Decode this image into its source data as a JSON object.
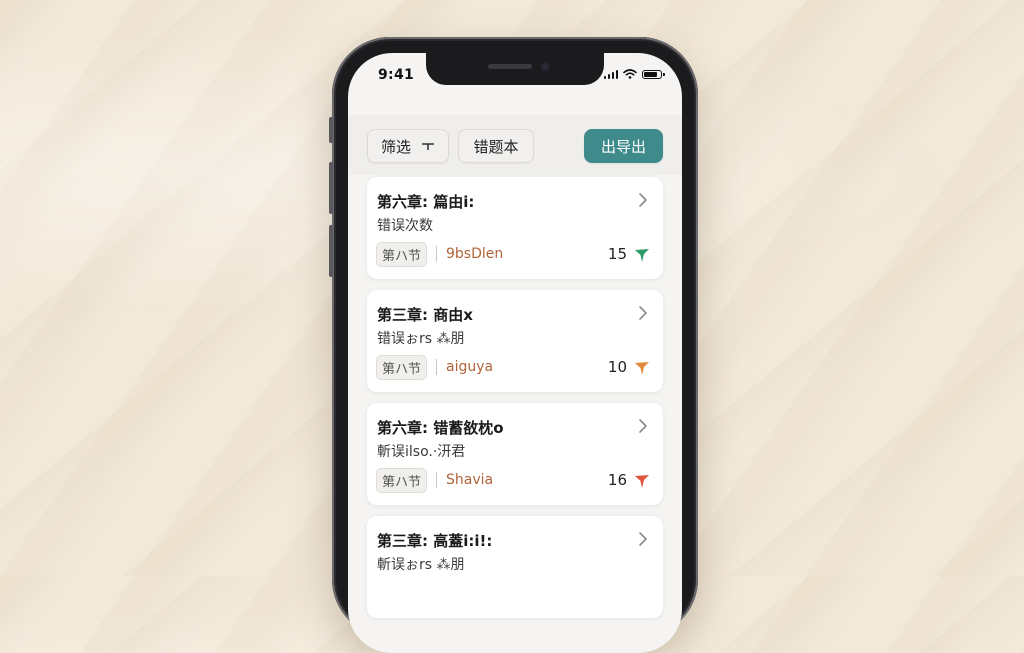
{
  "status_bar": {
    "time": "9:41"
  },
  "toolbar": {
    "filter_label": "筛选",
    "filter_icon": "filter-adjust-icon",
    "wrongbook_label": "错题本",
    "export_label": "出导出",
    "export_color": "#3f8a8a"
  },
  "cards": [
    {
      "title": "第六章: 篇由i:",
      "subtitle": "错误次数",
      "section": "第ハ节",
      "author": "9bsDlen",
      "count": "15",
      "pin_color": "#2f9a6a"
    },
    {
      "title": "第三章: 商由x",
      "subtitle": "错误ぉrs ⁂朋",
      "section": "第ハ节",
      "author": "aiguya",
      "count": "10",
      "pin_color": "#e08a3a"
    },
    {
      "title": "第六章: 错蓄敋枕o",
      "subtitle": "斬误ilso.·汧君",
      "section": "第ハ节",
      "author": "Shavia",
      "count": "16",
      "pin_color": "#e0553a"
    },
    {
      "title": "第三章: 高蓋i:i!:",
      "subtitle": "斬误ぉrs ⁂朋",
      "section": "",
      "author": "",
      "count": "",
      "pin_color": ""
    }
  ]
}
